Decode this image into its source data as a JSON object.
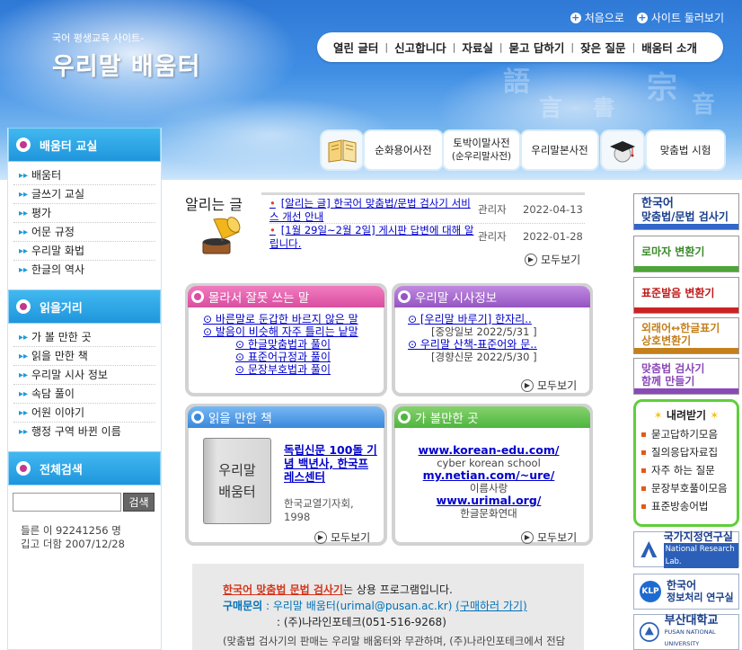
{
  "header": {
    "subtitle": "국어 평생교육 사이트-",
    "title": "우리말 배움터",
    "links": [
      {
        "label": "처음으로"
      },
      {
        "label": "사이트 둘러보기"
      }
    ],
    "nav": [
      "열린 글터",
      "신고합니다",
      "자료실",
      "묻고 답하기",
      "잦은 질문",
      "배움터 소개"
    ],
    "dictionaries": [
      {
        "label": "순화용어사전"
      },
      {
        "label": "토박이말사전",
        "sub": "(순우리말사전)"
      },
      {
        "label": "우리말본사전"
      },
      {
        "label": "맞춤법 시험"
      }
    ]
  },
  "sidebar": {
    "sections": [
      {
        "title": "배움터 교실",
        "items": [
          "배움터",
          "글쓰기 교실",
          "평가",
          "어문 규정",
          "우리말 화법",
          "한글의 역사"
        ]
      },
      {
        "title": "읽을거리",
        "items": [
          "가 볼 만한 곳",
          "읽을 만한 책",
          "우리말 시사 정보",
          "속담 풀이",
          "어원 이야기",
          "행정 구역 바뀐 이름"
        ]
      },
      {
        "title": "전체검색",
        "items": []
      }
    ],
    "search": {
      "button": "검색",
      "value": ""
    },
    "stats": [
      "들른 이 92241256 명",
      "깁고 더함 2007/12/28"
    ]
  },
  "notice": {
    "label": "알리는 글",
    "rows": [
      {
        "title": "[알리는 글] 한국어 맞춤법/문법 검사기 서비스 개선 안내",
        "author": "관리자",
        "date": "2022-04-13"
      },
      {
        "title": "[1월 29일~2월 2일] 게시판 답변에 대해 알립니다.",
        "author": "관리자",
        "date": "2022-01-28"
      }
    ],
    "more": "모두보기"
  },
  "boxes": {
    "mistakes": {
      "title": "몰라서 잘못 쓰는 말",
      "links": [
        "⊙ 바른말로 둔갑한 바르지 않은 말",
        "⊙ 발음이 비슷해 자주 틀리는 낱말",
        "⊙ 한글맞춤법과 풀이",
        "⊙ 표준어규정과 풀이",
        "⊙ 문장부호법과 풀이"
      ],
      "more": "모두보기"
    },
    "news": {
      "title": "우리말 시사정보",
      "items": [
        {
          "title": "⊙ [우리말 바루기] 한자리..",
          "src": "[중앙일보  2022/5/31 ]"
        },
        {
          "title": "⊙ 우리말 산책-표준어와 문..",
          "src": "[경향신문  2022/5/30 ]"
        }
      ],
      "more": "모두보기"
    },
    "books": {
      "title": "읽을 만한 책",
      "cover": "우리말 배움터",
      "book_title": "독립신문 100돌 기념 백년사, 한국프레스센터",
      "publisher": "한국교열기자회, 1998",
      "more": "모두보기"
    },
    "places": {
      "title": "가 볼만한 곳",
      "sites": [
        {
          "url": "www.korean-edu.com/",
          "name": "cyber korean school"
        },
        {
          "url": "my.netian.com/~ure/",
          "name": "이름사랑"
        },
        {
          "url": "www.urimal.org/",
          "name": "한글문화연대"
        }
      ],
      "more": "모두보기"
    }
  },
  "right": {
    "buttons": [
      {
        "l1": "한국어",
        "l2": "맞춤법/문법 검사기",
        "color": "#3266c8"
      },
      {
        "l1": "로마자 변환기",
        "l2": "",
        "color": "#4fa43a"
      },
      {
        "l1": "표준발음 변환기",
        "l2": "",
        "color": "#cc2222"
      },
      {
        "l1": "외래어↔한글표기",
        "l2": "상호변환기",
        "color": "#c4801c"
      },
      {
        "l1": "맞춤법 검사기",
        "l2": "함께 만들기",
        "color": "#8a49b8"
      }
    ],
    "downloads": {
      "title": "내려받기",
      "items": [
        "묻고답하기모음",
        "질의응답자료집",
        "자주 하는 질문",
        "문장부호풀이모음",
        "표준방송어법"
      ]
    },
    "logos": [
      {
        "l1": "국가지정연구실",
        "l2": "National Research Lab."
      },
      {
        "l1": "한국어",
        "l2": "정보처리 연구실"
      },
      {
        "l1": "부산대학교",
        "l2": "PUSAN NATIONAL UNIVERSITY"
      }
    ]
  },
  "bottom": {
    "link": "한국어 맞춤법 문법 검사기",
    "line1_rest": "는 상용 프로그램입니다.",
    "buy_label": "구매문의",
    "buy1": "우리말 배움터(urimal@pusan.ac.kr)",
    "buy_link": "(구매하러 가기)",
    "buy2": "(주)나라인포테크(051-516-9268)",
    "note": "(맞춤법 검사기의 판매는 우리말 배움터와 무관하며, (주)나라인포테크에서 전담합니다.)"
  },
  "colors": {
    "mistakes": "#e254a6",
    "news": "#a05ac8",
    "books": "#3f8fe0",
    "places": "#4fb53f"
  }
}
